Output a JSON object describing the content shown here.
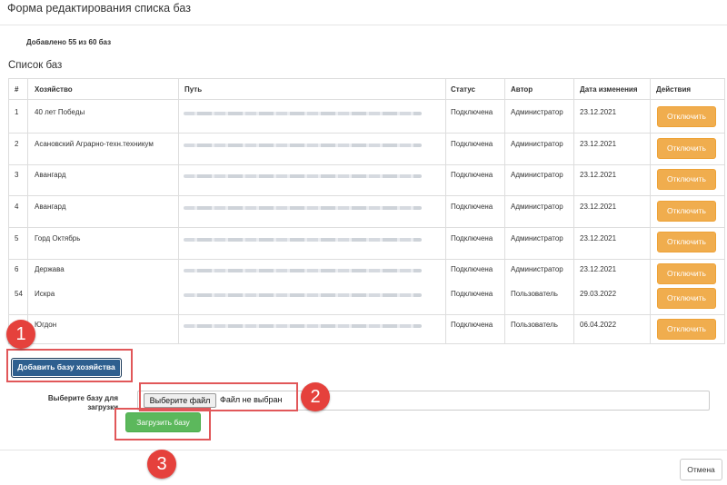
{
  "modal": {
    "title": "Форма редактирования списка баз",
    "added_info": "Добавлено 55 из 60 баз",
    "list_title": "Список баз"
  },
  "table": {
    "columns": [
      "#",
      "Хозяйство",
      "Путь",
      "Статус",
      "Автор",
      "Дата изменения",
      "Действия"
    ],
    "rows": [
      {
        "num": "1",
        "farm": "40 лет Победы",
        "status": "Подключена",
        "author": "Администратор",
        "date": "23.12.2021",
        "action": "Отключить"
      },
      {
        "num": "2",
        "farm": "Асановский Аграрно-техн.техникум",
        "status": "Подключена",
        "author": "Администратор",
        "date": "23.12.2021",
        "action": "Отключить"
      },
      {
        "num": "3",
        "farm": "Авангард",
        "status": "Подключена",
        "author": "Администратор",
        "date": "23.12.2021",
        "action": "Отключить"
      },
      {
        "num": "4",
        "farm": "Авангард",
        "status": "Подключена",
        "author": "Администратор",
        "date": "23.12.2021",
        "action": "Отключить"
      },
      {
        "num": "5",
        "farm": "Горд Октябрь",
        "status": "Подключена",
        "author": "Администратор",
        "date": "23.12.2021",
        "action": "Отключить"
      },
      {
        "num": "6",
        "farm": "Держава",
        "status": "Подключена",
        "author": "Администратор",
        "date": "23.12.2021",
        "action": "Отключить"
      },
      {
        "num": "54",
        "farm": "Искра",
        "status": "Подключена",
        "author": "Пользователь",
        "date": "29.03.2022",
        "action": "Отключить"
      },
      {
        "num": "",
        "farm": "Югдон",
        "status": "Подключена",
        "author": "Пользователь",
        "date": "06.04.2022",
        "action": "Отключить"
      }
    ]
  },
  "actions": {
    "add_label": "Добавить базу хозяйства",
    "choose_label": "Выберите базу для загрузки",
    "file_button": "Выберите файл",
    "file_status": "Файл не выбран",
    "upload_label": "Загрузить базу",
    "cancel_label": "Отмена"
  },
  "annotations": {
    "badge_1": "1",
    "badge_2": "2",
    "badge_3": "3",
    "color": "#e5413c"
  },
  "colors": {
    "orange_button": "#f0ad4e",
    "blue_button": "#2e5f8f",
    "green_button": "#5cb85c",
    "highlight_box": "#e15759"
  }
}
